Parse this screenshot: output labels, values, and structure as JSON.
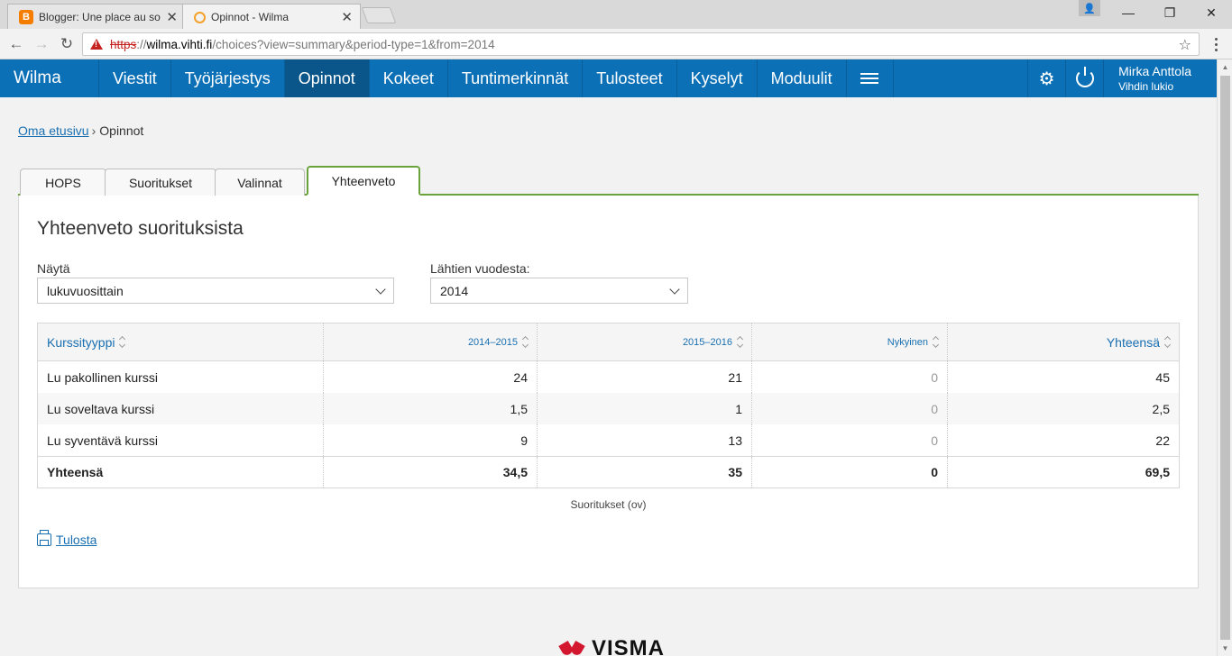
{
  "browser": {
    "tabs": [
      {
        "title": "Blogger: Une place au so"
      },
      {
        "title": "Opinnot - Wilma"
      }
    ],
    "url": {
      "scheme": "https",
      "sep": "://",
      "host": "wilma.vihti.fi",
      "rest": "/choices?view=summary&period-type=1&from=2014"
    }
  },
  "nav": {
    "brand": "Wilma",
    "items": [
      "Viestit",
      "Työjärjestys",
      "Opinnot",
      "Kokeet",
      "Tuntimerkinnät",
      "Tulosteet",
      "Kyselyt",
      "Moduulit"
    ],
    "user_name": "Mirka Anttola",
    "school": "Vihdin lukio"
  },
  "breadcrumb": {
    "home": "Oma etusivu",
    "sep": "›",
    "current": "Opinnot"
  },
  "tabs": [
    "HOPS",
    "Suoritukset",
    "Valinnat",
    "Yhteenveto"
  ],
  "panel": {
    "title": "Yhteenveto suorituksista",
    "show_label": "Näytä",
    "show_value": "lukuvuosittain",
    "from_label": "Lähtien vuodesta:",
    "from_value": "2014",
    "caption": "Suoritukset (ov)",
    "print_label": "Tulosta"
  },
  "table": {
    "headers": [
      "Kurssityyppi",
      "2014–2015",
      "2015–2016",
      "Nykyinen",
      "Yhteensä"
    ],
    "rows": [
      [
        "Lu pakollinen kurssi",
        "24",
        "21",
        "0",
        "45"
      ],
      [
        "Lu soveltava kurssi",
        "1,5",
        "1",
        "0",
        "2,5"
      ],
      [
        "Lu syventävä kurssi",
        "9",
        "13",
        "0",
        "22"
      ]
    ],
    "total": [
      "Yhteensä",
      "34,5",
      "35",
      "0",
      "69,5"
    ]
  },
  "footer": {
    "logo_text": "VISMA"
  }
}
